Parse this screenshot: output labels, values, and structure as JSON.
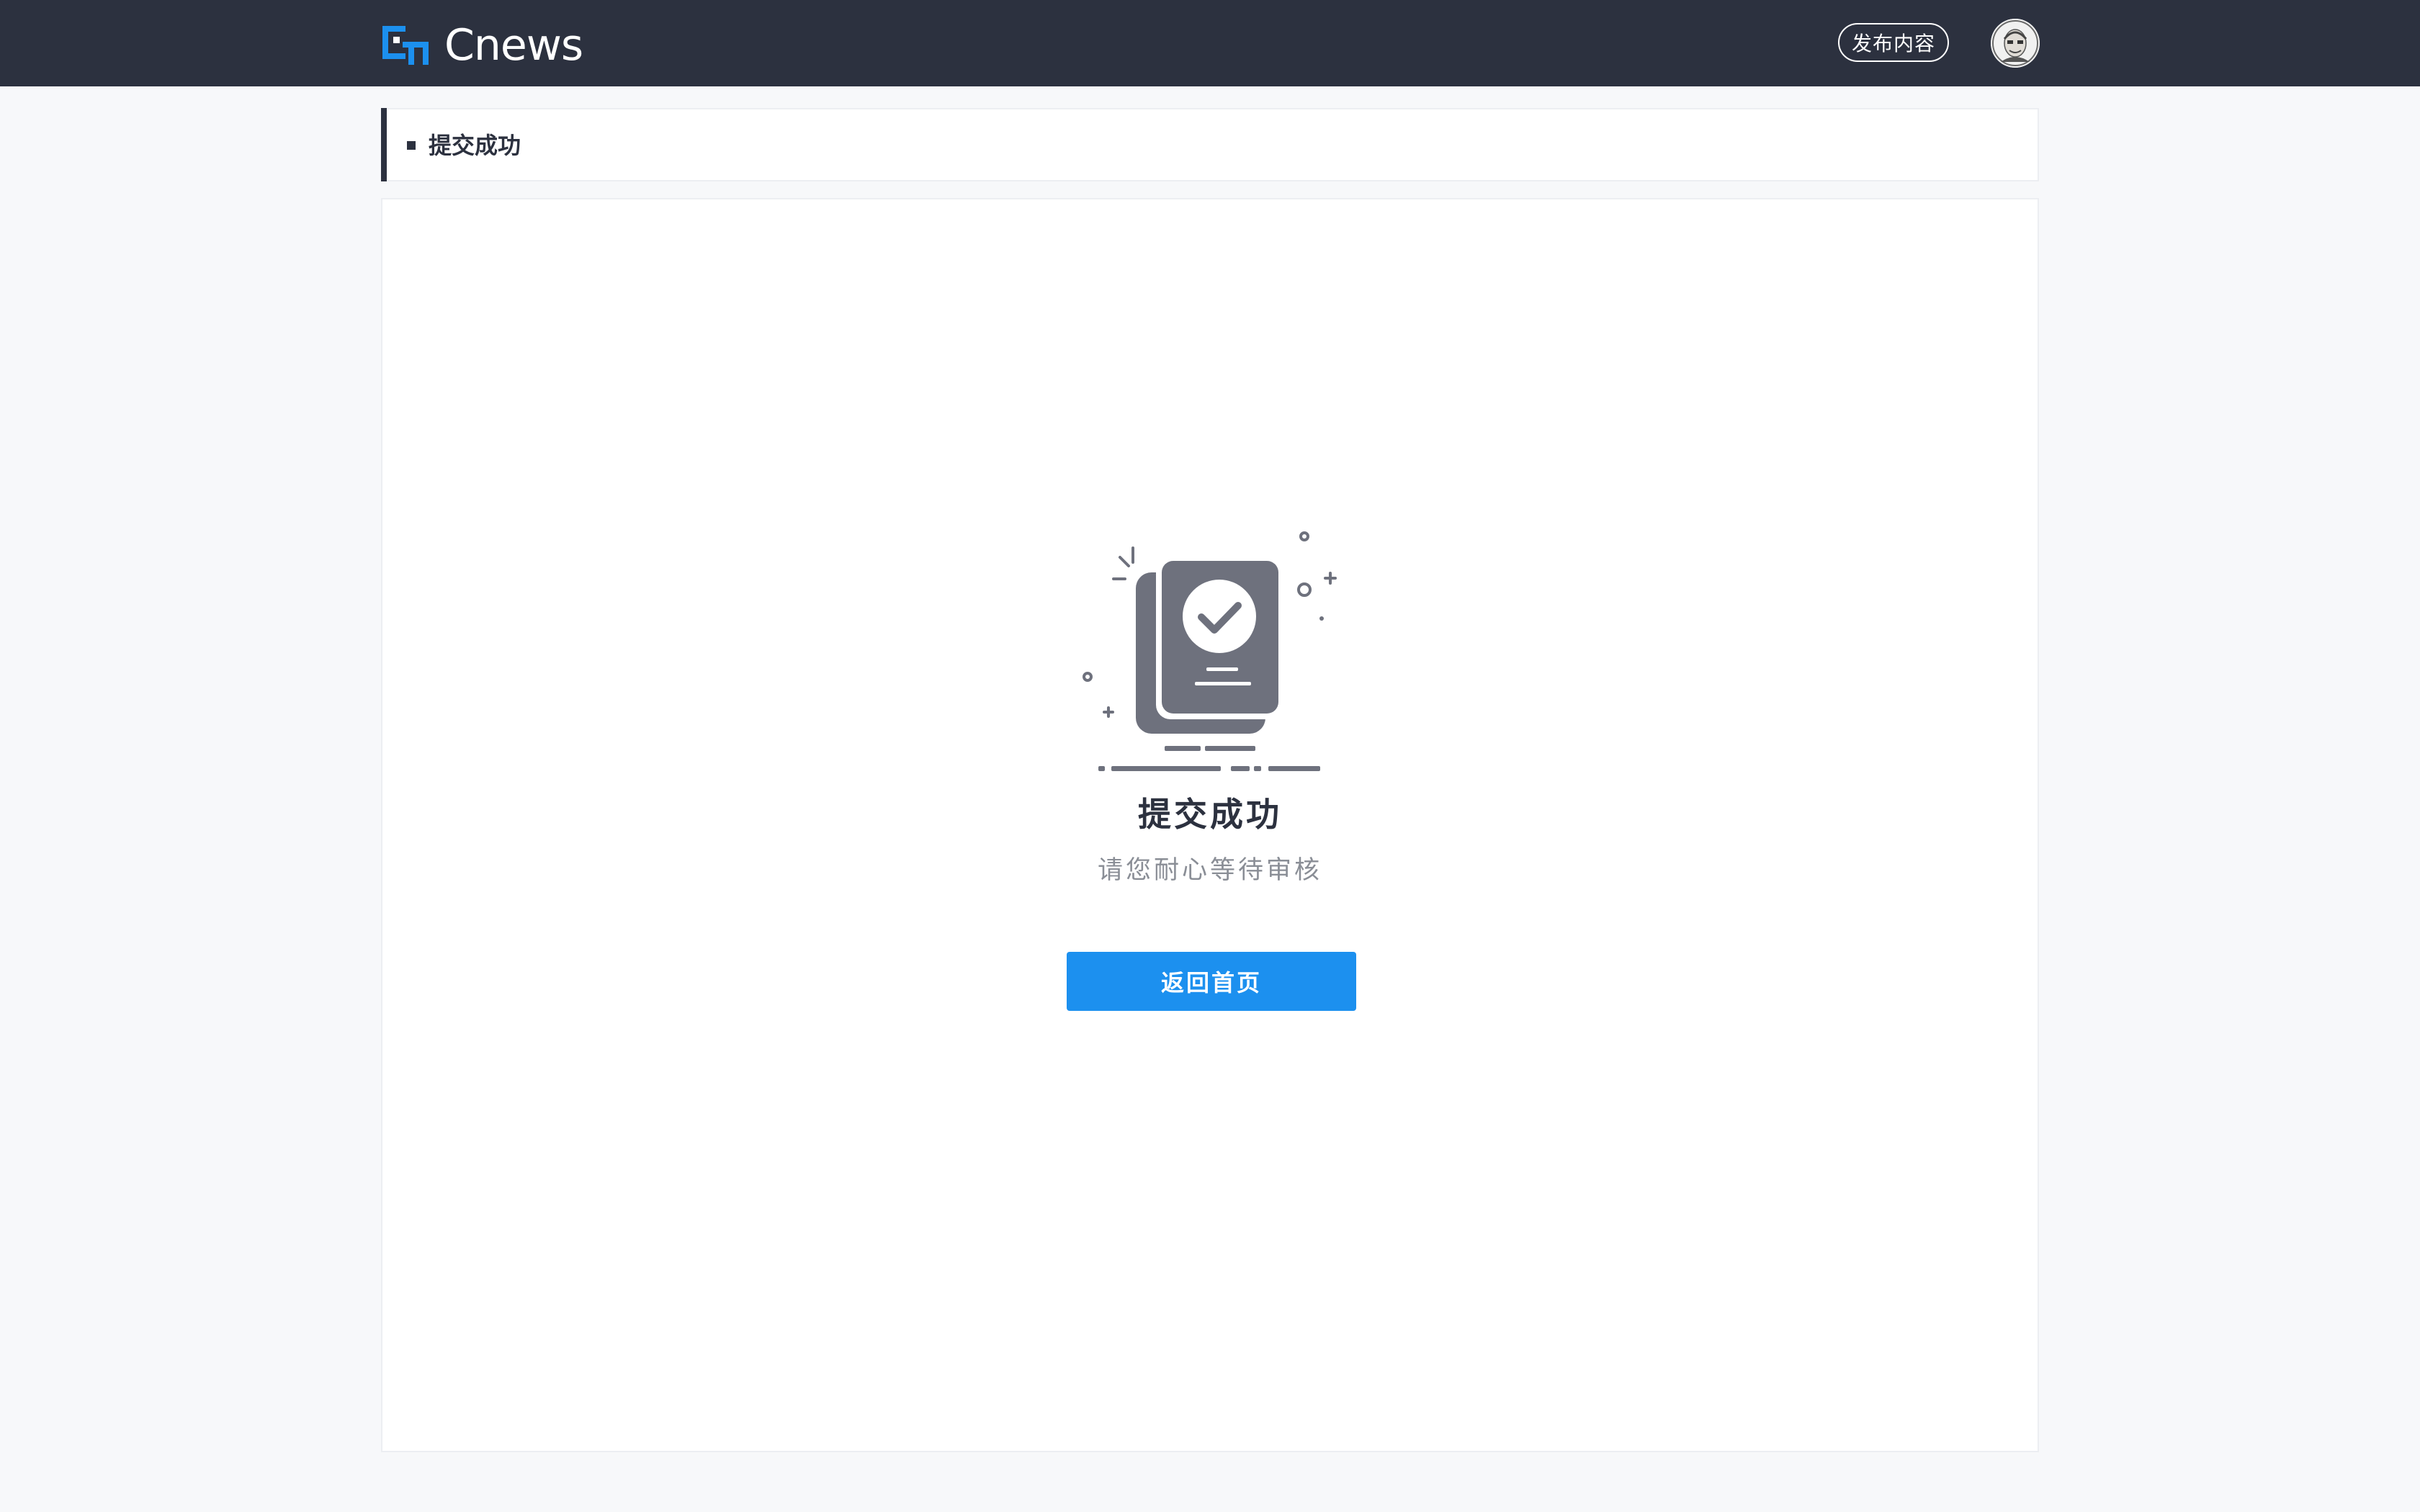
{
  "header": {
    "logo_text": "Cnews",
    "logo_icon": "cnews-logo-icon",
    "publish_label": "发布内容",
    "avatar_icon": "user-avatar"
  },
  "page_title": {
    "text": "提交成功"
  },
  "result": {
    "illustration_icon": "document-check-icon",
    "title": "提交成功",
    "subtitle": "请您耐心等待审核",
    "home_button_label": "返回首页"
  },
  "colors": {
    "header_bg": "#2c313f",
    "page_bg": "#f7f8fa",
    "accent_blue": "#1c90ef",
    "illustration_gray": "#6e717d",
    "text_dark": "#2c313f",
    "text_muted": "#8a8e96"
  }
}
